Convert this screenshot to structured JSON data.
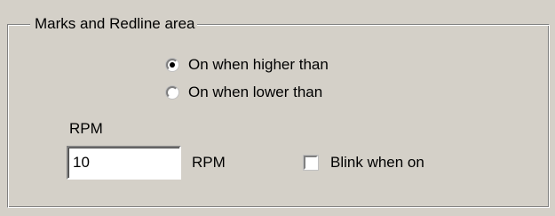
{
  "group": {
    "title": "Marks and Redline area"
  },
  "radios": [
    {
      "label": "On when higher than",
      "checked": true
    },
    {
      "label": "On when lower than",
      "checked": false
    }
  ],
  "rpm_field": {
    "caption": "RPM",
    "value": "10",
    "unit": "RPM"
  },
  "blink": {
    "label": "Blink when on",
    "checked": false
  }
}
